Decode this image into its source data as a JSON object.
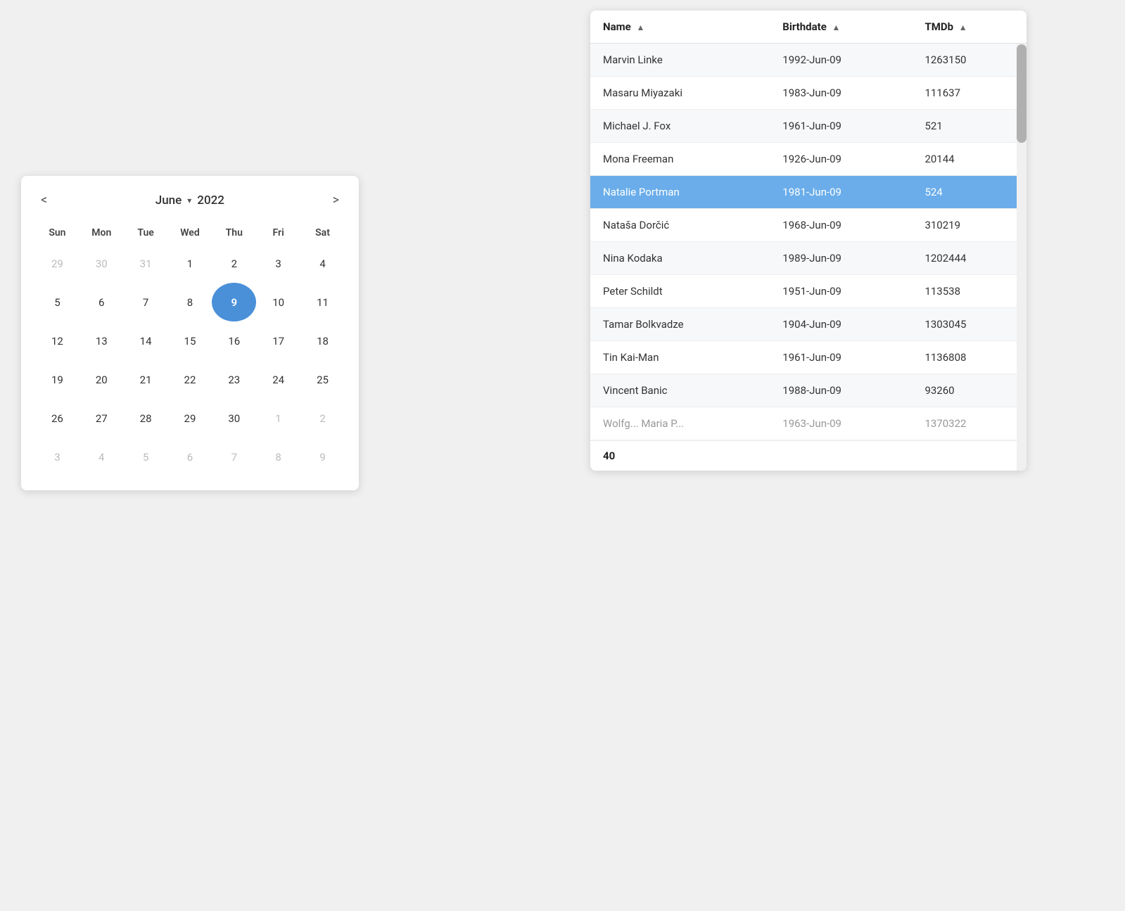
{
  "calendar": {
    "month": "June",
    "year": "2022",
    "prev_label": "<",
    "next_label": ">",
    "days_header": [
      "Sun",
      "Mon",
      "Tue",
      "Wed",
      "Thu",
      "Fri",
      "Sat"
    ],
    "weeks": [
      [
        {
          "day": "29",
          "other": true
        },
        {
          "day": "30",
          "other": true
        },
        {
          "day": "31",
          "other": true
        },
        {
          "day": "1",
          "other": false
        },
        {
          "day": "2",
          "other": false
        },
        {
          "day": "3",
          "other": false
        },
        {
          "day": "4",
          "other": false
        }
      ],
      [
        {
          "day": "5",
          "other": false
        },
        {
          "day": "6",
          "other": false
        },
        {
          "day": "7",
          "other": false
        },
        {
          "day": "8",
          "other": false
        },
        {
          "day": "9",
          "other": false,
          "selected": true
        },
        {
          "day": "10",
          "other": false
        },
        {
          "day": "11",
          "other": false
        }
      ],
      [
        {
          "day": "12",
          "other": false
        },
        {
          "day": "13",
          "other": false
        },
        {
          "day": "14",
          "other": false
        },
        {
          "day": "15",
          "other": false
        },
        {
          "day": "16",
          "other": false
        },
        {
          "day": "17",
          "other": false
        },
        {
          "day": "18",
          "other": false
        }
      ],
      [
        {
          "day": "19",
          "other": false
        },
        {
          "day": "20",
          "other": false
        },
        {
          "day": "21",
          "other": false
        },
        {
          "day": "22",
          "other": false
        },
        {
          "day": "23",
          "other": false
        },
        {
          "day": "24",
          "other": false
        },
        {
          "day": "25",
          "other": false
        }
      ],
      [
        {
          "day": "26",
          "other": false
        },
        {
          "day": "27",
          "other": false
        },
        {
          "day": "28",
          "other": false
        },
        {
          "day": "29",
          "other": false
        },
        {
          "day": "30",
          "other": false
        },
        {
          "day": "1",
          "other": true
        },
        {
          "day": "2",
          "other": true
        }
      ],
      [
        {
          "day": "3",
          "other": true
        },
        {
          "day": "4",
          "other": true
        },
        {
          "day": "5",
          "other": true
        },
        {
          "day": "6",
          "other": true
        },
        {
          "day": "7",
          "other": true
        },
        {
          "day": "8",
          "other": true
        },
        {
          "day": "9",
          "other": true
        }
      ]
    ]
  },
  "table": {
    "columns": [
      {
        "label": "Name",
        "sort_icon": "▲"
      },
      {
        "label": "Birthdate",
        "sort_icon": "▲"
      },
      {
        "label": "TMDb",
        "sort_icon": "▲"
      }
    ],
    "rows": [
      {
        "name": "Marvin Linke",
        "birthdate": "1992-Jun-09",
        "tmdb": "1263150",
        "truncated": true
      },
      {
        "name": "Masaru Miyazaki",
        "birthdate": "1983-Jun-09",
        "tmdb": "111637",
        "truncated": false
      },
      {
        "name": "Michael J. Fox",
        "birthdate": "1961-Jun-09",
        "tmdb": "521",
        "truncated": false
      },
      {
        "name": "Mona Freeman",
        "birthdate": "1926-Jun-09",
        "tmdb": "20144",
        "truncated": false
      },
      {
        "name": "Natalie Portman",
        "birthdate": "1981-Jun-09",
        "tmdb": "524",
        "selected": true,
        "truncated": false
      },
      {
        "name": "Nataša Dorčić",
        "birthdate": "1968-Jun-09",
        "tmdb": "310219",
        "truncated": false
      },
      {
        "name": "Nina Kodaka",
        "birthdate": "1989-Jun-09",
        "tmdb": "1202444",
        "truncated": false
      },
      {
        "name": "Peter Schildt",
        "birthdate": "1951-Jun-09",
        "tmdb": "113538",
        "truncated": false
      },
      {
        "name": "Tamar Bolkvadze",
        "birthdate": "1904-Jun-09",
        "tmdb": "1303045",
        "truncated": false
      },
      {
        "name": "Tin Kai-Man",
        "birthdate": "1961-Jun-09",
        "tmdb": "1136808",
        "truncated": false
      },
      {
        "name": "Vincent Banic",
        "birthdate": "1988-Jun-09",
        "tmdb": "93260",
        "truncated": false
      },
      {
        "name": "Wolfg... Maria P...",
        "birthdate": "1963-Jun-09",
        "tmdb": "1370322",
        "truncated": true,
        "bottom_trunc": true
      }
    ],
    "footer_count": "40"
  }
}
